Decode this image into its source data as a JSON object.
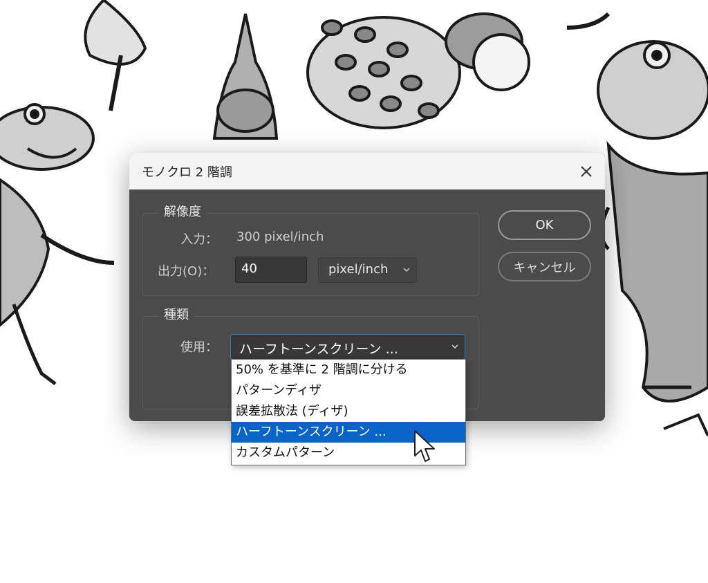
{
  "dialog": {
    "title": "モノクロ 2 階調",
    "close_icon": "close-icon"
  },
  "resolution": {
    "legend": "解像度",
    "input_label": "入力：",
    "input_value": "300 pixel/inch",
    "output_label": "出力(O)：",
    "output_value": "40",
    "unit_selected": "pixel/inch"
  },
  "type": {
    "legend": "種類",
    "use_label": "使用：",
    "selected": "ハーフトーンスクリーン ...",
    "options": [
      "50% を基準に 2 階調に分ける",
      "パターンディザ",
      "誤差拡散法 (ディザ)",
      "ハーフトーンスクリーン ...",
      "カスタムパターン"
    ],
    "highlighted_index": 3
  },
  "buttons": {
    "ok": "OK",
    "cancel": "キャンセル"
  },
  "colors": {
    "dialog_bg": "#4b4b4b",
    "titlebar_bg": "#f3f3f3",
    "selection": "#0a64c8"
  }
}
